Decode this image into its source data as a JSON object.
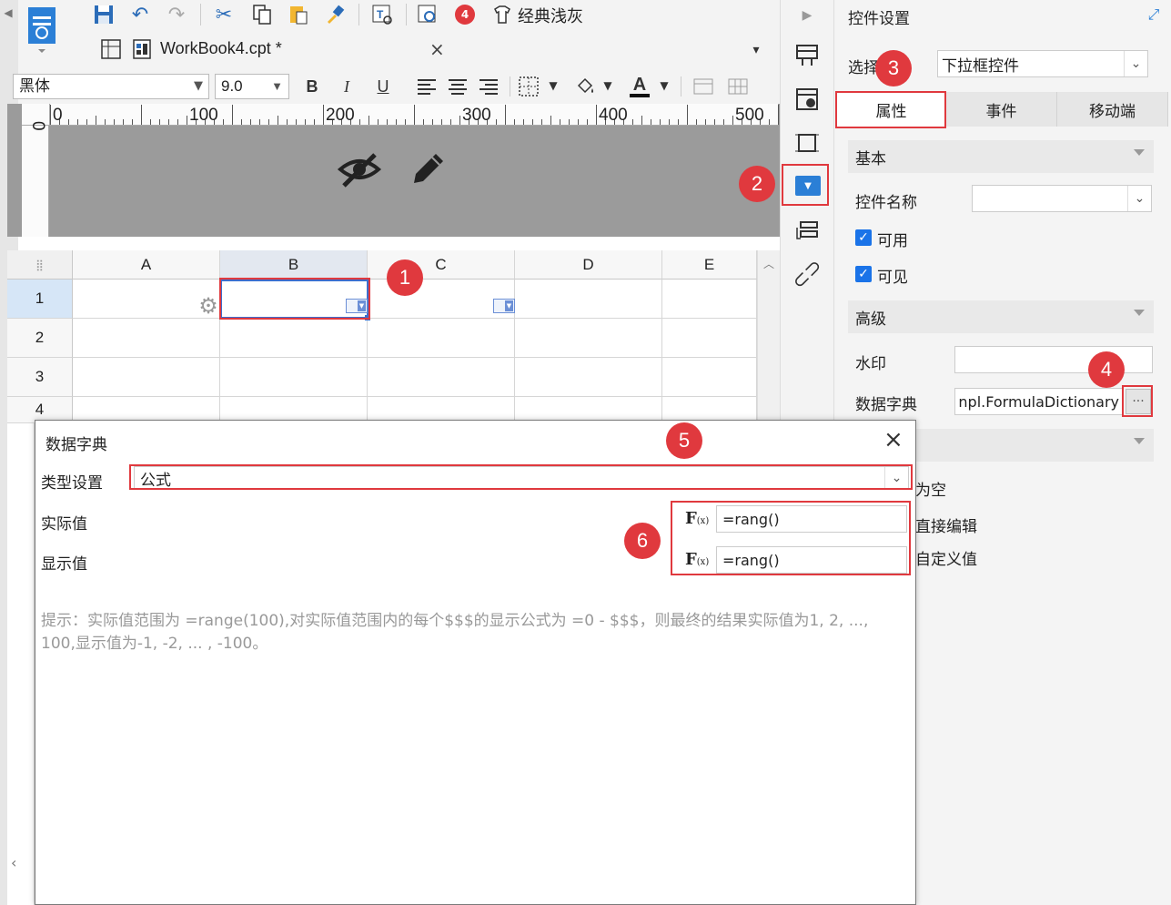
{
  "toolbar": {
    "classic_gray": "经典浅灰",
    "notify_count": "4",
    "font_name": "黑体",
    "font_size": "9.0",
    "bold": "B",
    "italic": "I",
    "underline": "U",
    "font_color_letter": "A"
  },
  "document_tab": {
    "title": "WorkBook4.cpt *",
    "close": "×"
  },
  "ruler": {
    "h_labels": [
      "0",
      "100",
      "200",
      "300",
      "400",
      "500"
    ],
    "v_label": "0"
  },
  "grid": {
    "columns": [
      "A",
      "B",
      "C",
      "D",
      "E"
    ],
    "rows": [
      "1",
      "2",
      "3",
      "4"
    ]
  },
  "right_panel": {
    "title": "控件设置",
    "select_label": "选择控件",
    "selected_widget": "下拉框控件",
    "tabs": [
      "属性",
      "事件",
      "移动端"
    ],
    "section_basic": "基本",
    "widget_name_label": "控件名称",
    "widget_name_value": "",
    "enabled_label": "可用",
    "visible_label": "可见",
    "section_advanced": "高级",
    "watermark_label": "水印",
    "watermark_value": "",
    "dictionary_label": "数据字典",
    "dictionary_value": "npl.FormulaDictionary",
    "dictionary_button": "···",
    "partial_1": "为空",
    "partial_2": "直接编辑",
    "partial_3": "自定义值"
  },
  "dialog": {
    "title": "数据字典",
    "close": "×",
    "type_label": "类型设置",
    "type_value": "公式",
    "actual_label": "实际值",
    "actual_value": "=rang()",
    "display_label": "显示值",
    "display_value": "=rang()",
    "hint": "提示：实际值范围为 =range(100),对实际值范围内的每个$$$的显示公式为 =0 - $$$，则最终的结果实际值为1, 2, ..., 100,显示值为-1, -2, ... , -100。"
  },
  "badges": [
    "1",
    "2",
    "3",
    "4",
    "5",
    "6"
  ],
  "colors": {
    "accent": "#e0393e",
    "check": "#1a73e8",
    "selection": "#3d6ecc"
  }
}
